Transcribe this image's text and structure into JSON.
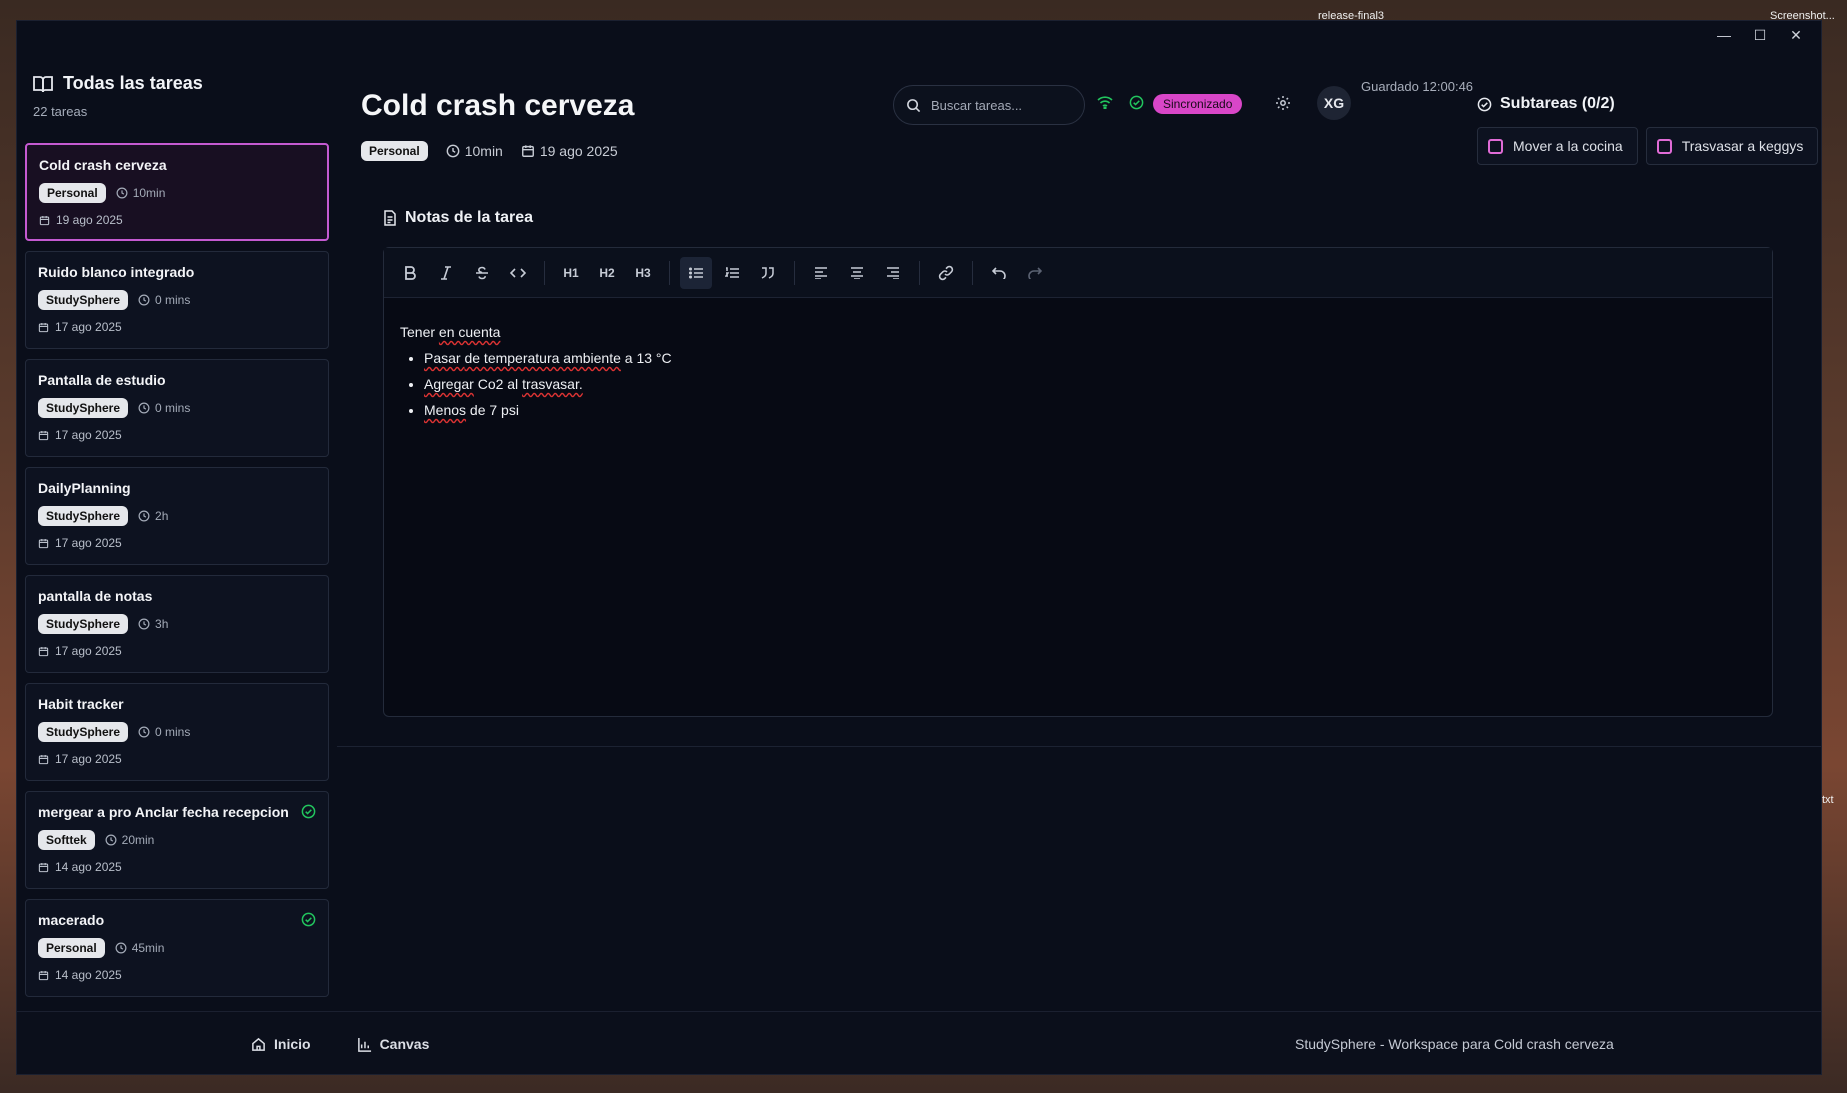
{
  "desktop": {
    "label_1": "release-final3",
    "label_2": "Screenshot...",
    "label_3": "txt"
  },
  "window": {
    "controls": [
      "—",
      "☐",
      "✕"
    ]
  },
  "sidebar": {
    "title": "Todas las tareas",
    "count": "22 tareas",
    "tasks": [
      {
        "title": "Cold crash cerveza",
        "tag": "Personal",
        "time": "10min",
        "date": "19 ago 2025",
        "done": false
      },
      {
        "title": "Ruido blanco integrado",
        "tag": "StudySphere",
        "time": "0 mins",
        "date": "17 ago 2025",
        "done": false
      },
      {
        "title": "Pantalla de estudio",
        "tag": "StudySphere",
        "time": "0 mins",
        "date": "17 ago 2025",
        "done": false
      },
      {
        "title": "DailyPlanning",
        "tag": "StudySphere",
        "time": "2h",
        "date": "17 ago 2025",
        "done": false
      },
      {
        "title": "pantalla de notas",
        "tag": "StudySphere",
        "time": "3h",
        "date": "17 ago 2025",
        "done": false
      },
      {
        "title": "Habit tracker",
        "tag": "StudySphere",
        "time": "0 mins",
        "date": "17 ago 2025",
        "done": false
      },
      {
        "title": "mergear a pro Anclar fecha recepcion",
        "tag": "Softtek",
        "time": "20min",
        "date": "14 ago 2025",
        "done": true
      },
      {
        "title": "macerado",
        "tag": "Personal",
        "time": "45min",
        "date": "14 ago 2025",
        "done": true
      }
    ]
  },
  "header": {
    "title": "Cold crash cerveza",
    "tag": "Personal",
    "time": "10min",
    "date": "19 ago 2025",
    "search_placeholder": "Buscar tareas...",
    "sync_label": "Sincronizado",
    "avatar": "XG",
    "saved": "Guardado 12:00:46",
    "colors": {
      "accent": "#d946c8",
      "ok": "#22c55e"
    }
  },
  "subtasks": {
    "title": "Subtareas (0/2)",
    "items": [
      "Mover a la cocina",
      "Trasvasar a keggys"
    ]
  },
  "notes": {
    "title": "Notas de la tarea",
    "toolbar": {
      "h1": "H1",
      "h2": "H2",
      "h3": "H3"
    },
    "intro_a": "Tener ",
    "intro_b": "en cuenta",
    "bullets": [
      {
        "a": "Pasar ",
        "b": "de temperatura ambiente",
        "c": " a 13 °C"
      },
      {
        "a": "Agregar",
        "b": " Co2 al ",
        "c": "trasvasar."
      },
      {
        "a": "Menos",
        "b": " de 7 psi",
        "c": ""
      }
    ]
  },
  "footer": {
    "home": "Inicio",
    "canvas": "Canvas",
    "status": "StudySphere - Workspace para Cold crash cerveza"
  }
}
